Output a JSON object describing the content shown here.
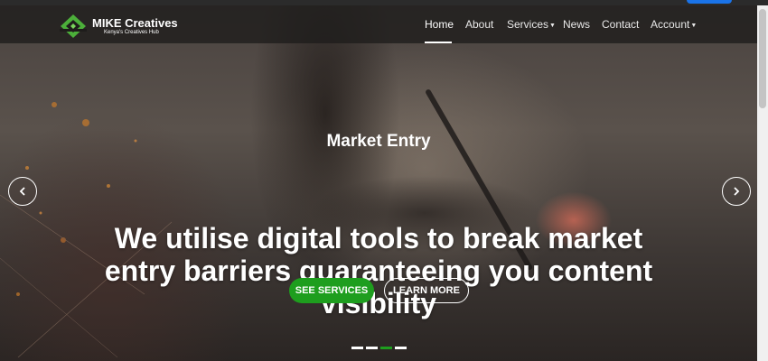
{
  "brand": {
    "name": "MIKE Creatives",
    "tagline": "Kenya's Creatives Hub",
    "logo_icon": "green-diamond-logo-icon"
  },
  "nav": {
    "items": [
      {
        "label": "Home",
        "active": true
      },
      {
        "label": "About",
        "active": false
      },
      {
        "label": "Services",
        "dropdown": true
      },
      {
        "label": "News",
        "active": false
      },
      {
        "label": "Contact",
        "active": false
      },
      {
        "label": "Account",
        "dropdown": true
      }
    ]
  },
  "hero": {
    "subtitle": "Market Entry",
    "headline": "We utilise digital tools to break market entry barriers guaranteeing you content visibility",
    "primary_button": "SEE SERVICES",
    "secondary_button": "LEARN MORE"
  },
  "carousel": {
    "prev_icon": "chevron-left-icon",
    "next_icon": "chevron-right-icon",
    "slide_count": 4,
    "active_index": 2
  },
  "colors": {
    "accent": "#1e9e1e",
    "navbar": "#1e1c1b"
  }
}
